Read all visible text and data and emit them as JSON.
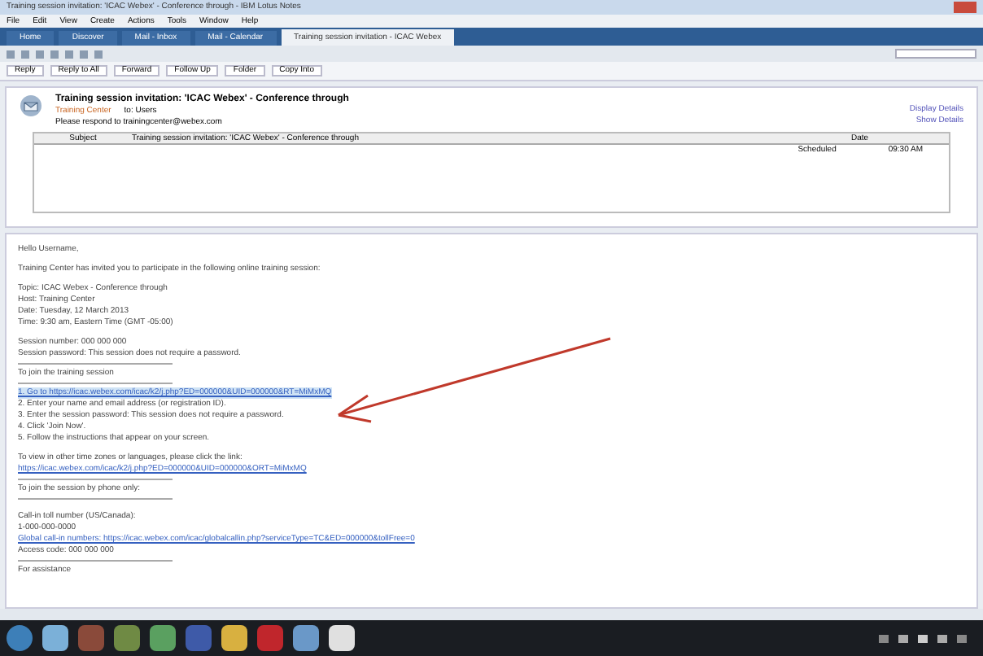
{
  "window": {
    "title": "Training session invitation: 'ICAC Webex' - Conference through - IBM Lotus Notes"
  },
  "menu": [
    "File",
    "Edit",
    "View",
    "Create",
    "Actions",
    "Tools",
    "Window",
    "Help"
  ],
  "tabs": [
    {
      "label": "Home",
      "selected": false
    },
    {
      "label": "Discover",
      "selected": false
    },
    {
      "label": "Mail - Inbox",
      "selected": false
    },
    {
      "label": "Mail - Calendar",
      "selected": false
    },
    {
      "label": "Training session invitation - ICAC Webex",
      "selected": true
    }
  ],
  "actions": [
    "Reply",
    "Reply to All",
    "Forward",
    "Follow Up",
    "Folder",
    "Copy Into"
  ],
  "header": {
    "subject": "Training session invitation: 'ICAC Webex' - Conference through",
    "from": "Training Center",
    "to": "to: Users",
    "note": "Please respond to trainingcenter@webex.com",
    "links": [
      "Display Details",
      "Show Details"
    ],
    "table": {
      "columns": [
        "Subject",
        "Training session invitation: 'ICAC Webex' - Conference through",
        "Date"
      ],
      "row": [
        "Scheduled",
        "09:30 AM"
      ]
    }
  },
  "body": [
    {
      "kind": "text",
      "text": "Hello Username,"
    },
    {
      "kind": "gap"
    },
    {
      "kind": "text",
      "text": "Training Center has invited you to participate in the following online training session:"
    },
    {
      "kind": "gap"
    },
    {
      "kind": "text",
      "text": "Topic: ICAC Webex - Conference through"
    },
    {
      "kind": "text",
      "text": "Host: Training Center"
    },
    {
      "kind": "text",
      "text": "Date: Tuesday, 12 March 2013"
    },
    {
      "kind": "text",
      "text": "Time: 9:30 am, Eastern Time (GMT -05:00)"
    },
    {
      "kind": "gap"
    },
    {
      "kind": "text",
      "text": "Session number: 000 000 000"
    },
    {
      "kind": "text",
      "text": "Session password: This session does not require a password."
    },
    {
      "kind": "rule"
    },
    {
      "kind": "text",
      "text": "To join the training session"
    },
    {
      "kind": "rule"
    },
    {
      "kind": "link",
      "text": "1. Go to https://icac.webex.com/icac/k2/j.php?ED=000000&UID=000000&RT=MiMxMQ",
      "highlight": true
    },
    {
      "kind": "text",
      "text": "2. Enter your name and email address (or registration ID)."
    },
    {
      "kind": "text",
      "text": "3. Enter the session password: This session does not require a password."
    },
    {
      "kind": "text",
      "text": "4. Click 'Join Now'."
    },
    {
      "kind": "text",
      "text": "5. Follow the instructions that appear on your screen."
    },
    {
      "kind": "gap"
    },
    {
      "kind": "text",
      "text": "To view in other time zones or languages, please click the link:"
    },
    {
      "kind": "link",
      "text": "https://icac.webex.com/icac/k2/j.php?ED=000000&UID=000000&ORT=MiMxMQ",
      "highlight": false
    },
    {
      "kind": "rule"
    },
    {
      "kind": "text",
      "text": "To join the session by phone only:"
    },
    {
      "kind": "rule"
    },
    {
      "kind": "gap"
    },
    {
      "kind": "text",
      "text": "Call-in toll number (US/Canada):"
    },
    {
      "kind": "text",
      "text": "1-000-000-0000"
    },
    {
      "kind": "link",
      "text": "Global call-in numbers: https://icac.webex.com/icac/globalcallin.php?serviceType=TC&ED=000000&tollFree=0",
      "highlight": false
    },
    {
      "kind": "text",
      "text": "Access code: 000 000 000"
    },
    {
      "kind": "rule"
    },
    {
      "kind": "text",
      "text": "For assistance"
    }
  ]
}
